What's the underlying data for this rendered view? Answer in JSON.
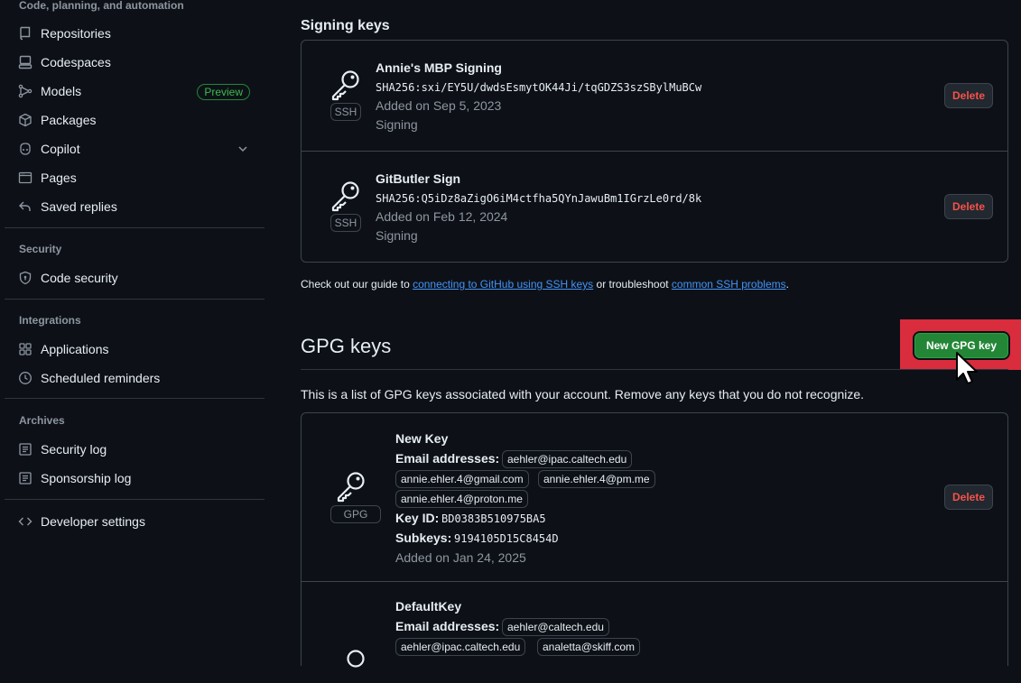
{
  "sidebar": {
    "top_heading": "Code, planning, and automation",
    "items_code": [
      {
        "label": "Repositories",
        "icon": "repo-icon"
      },
      {
        "label": "Codespaces",
        "icon": "codespaces-icon"
      },
      {
        "label": "Models",
        "icon": "models-icon",
        "badge": "Preview"
      },
      {
        "label": "Packages",
        "icon": "package-icon"
      },
      {
        "label": "Copilot",
        "icon": "copilot-icon"
      },
      {
        "label": "Pages",
        "icon": "browser-icon"
      },
      {
        "label": "Saved replies",
        "icon": "reply-icon"
      }
    ],
    "security_heading": "Security",
    "security_items": [
      {
        "label": "Code security",
        "icon": "shield-icon"
      }
    ],
    "integrations_heading": "Integrations",
    "integrations_items": [
      {
        "label": "Applications",
        "icon": "apps-icon"
      },
      {
        "label": "Scheduled reminders",
        "icon": "clock-icon"
      }
    ],
    "archives_heading": "Archives",
    "archives_items": [
      {
        "label": "Security log",
        "icon": "log-icon"
      },
      {
        "label": "Sponsorship log",
        "icon": "log-icon"
      }
    ],
    "developer_settings": "Developer settings"
  },
  "signing": {
    "title": "Signing keys",
    "keys": [
      {
        "name": "Annie's MBP Signing",
        "type": "SSH",
        "fingerprint": "SHA256:sxi/EY5U/dwdsEsmytOK44Ji/tqGDZS3szSBylMuBCw",
        "added": "Added on Sep 5, 2023",
        "usage": "Signing",
        "delete": "Delete"
      },
      {
        "name": "GitButler Sign",
        "type": "SSH",
        "fingerprint": "SHA256:Q5iDz8aZigO6iM4ctfha5QYnJawuBm1IGrzLe0rd/8k",
        "added": "Added on Feb 12, 2024",
        "usage": "Signing",
        "delete": "Delete"
      }
    ]
  },
  "guide": {
    "prefix": "Check out our guide to ",
    "link1": "connecting to GitHub using SSH keys",
    "middle": " or troubleshoot ",
    "link2": "common SSH problems",
    "suffix": "."
  },
  "gpg": {
    "title": "GPG keys",
    "new_button": "New GPG key",
    "description": "This is a list of GPG keys associated with your account. Remove any keys that you do not recognize.",
    "email_label": "Email addresses:",
    "keyid_label": "Key ID:",
    "subkeys_label": "Subkeys:",
    "keys": [
      {
        "name": "New Key",
        "type": "GPG",
        "emails": [
          "aehler@ipac.caltech.edu",
          "annie.ehler.4@gmail.com",
          "annie.ehler.4@pm.me",
          "annie.ehler.4@proton.me"
        ],
        "key_id": "BD0383B510975BA5",
        "subkeys": "9194105D15C8454D",
        "added": "Added on Jan 24, 2025",
        "delete": "Delete"
      },
      {
        "name": "DefaultKey",
        "emails": [
          "aehler@caltech.edu",
          "aehler@ipac.caltech.edu",
          "analetta@skiff.com"
        ]
      }
    ]
  },
  "colors": {
    "accent_green": "#238636",
    "danger": "#f85149",
    "link": "#4493f8",
    "highlight": "#d92c3d",
    "bg": "#0d1117"
  }
}
